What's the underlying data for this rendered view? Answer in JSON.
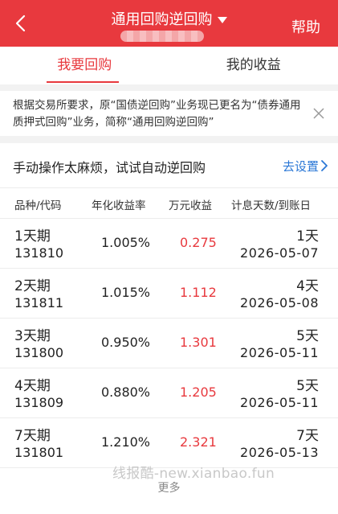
{
  "header": {
    "title": "通用回购逆回购",
    "help_label": "帮助"
  },
  "tabs": [
    {
      "label": "我要回购",
      "active": true
    },
    {
      "label": "我的收益",
      "active": false
    }
  ],
  "notice": {
    "text": "根据交易所要求，原“国债逆回购”业务现已更名为“债券通用质押式回购”业务，简称“通用回购逆回购”"
  },
  "auto": {
    "text": "手动操作太麻烦，试试自动逆回购",
    "link_label": "去设置"
  },
  "table": {
    "headers": [
      "品种/代码",
      "年化收益率",
      "万元收益",
      "计息天数/到账日"
    ],
    "rows": [
      {
        "name": "1天期",
        "code": "131810",
        "rate": "1.005%",
        "income": "0.275",
        "days": "1天",
        "date": "2026-05-07"
      },
      {
        "name": "2天期",
        "code": "131811",
        "rate": "1.015%",
        "income": "1.112",
        "days": "4天",
        "date": "2026-05-08"
      },
      {
        "name": "3天期",
        "code": "131800",
        "rate": "0.950%",
        "income": "1.301",
        "days": "5天",
        "date": "2026-05-11"
      },
      {
        "name": "4天期",
        "code": "131809",
        "rate": "0.880%",
        "income": "1.205",
        "days": "5天",
        "date": "2026-05-11"
      },
      {
        "name": "7天期",
        "code": "131801",
        "rate": "1.210%",
        "income": "2.321",
        "days": "7天",
        "date": "2026-05-13"
      }
    ]
  },
  "more_label": "更多",
  "watermark": "线报酷-new.xianbao.fun",
  "colors": {
    "brand_red": "#e8393e",
    "link_blue": "#2a77d6"
  },
  "icons": {
    "back": "chevron-left-icon",
    "dropdown": "caret-down-icon",
    "close": "close-icon",
    "link": "chevron-right-icon"
  }
}
